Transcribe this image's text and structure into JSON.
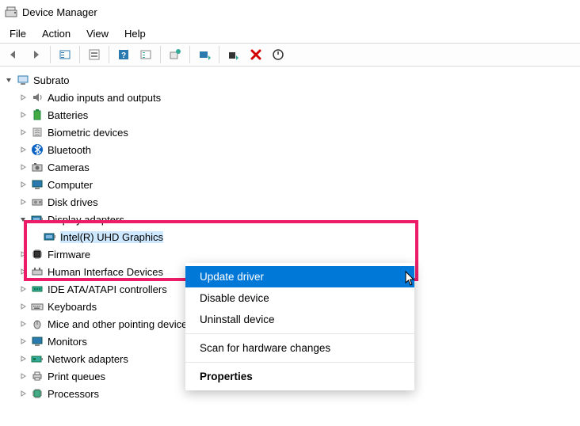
{
  "window": {
    "title": "Device Manager"
  },
  "menu": {
    "file": "File",
    "action": "Action",
    "view": "View",
    "help": "Help"
  },
  "root": {
    "name": "Subrato"
  },
  "categories": [
    {
      "id": "audio",
      "label": "Audio inputs and outputs"
    },
    {
      "id": "batteries",
      "label": "Batteries"
    },
    {
      "id": "biometric",
      "label": "Biometric devices"
    },
    {
      "id": "bluetooth",
      "label": "Bluetooth"
    },
    {
      "id": "cameras",
      "label": "Cameras"
    },
    {
      "id": "computer",
      "label": "Computer"
    },
    {
      "id": "disk",
      "label": "Disk drives"
    },
    {
      "id": "display",
      "label": "Display adapters"
    },
    {
      "id": "firmware",
      "label": "Firmware"
    },
    {
      "id": "hid",
      "label": "Human Interface Devices"
    },
    {
      "id": "ide",
      "label": "IDE ATA/ATAPI controllers"
    },
    {
      "id": "keyboards",
      "label": "Keyboards"
    },
    {
      "id": "mice",
      "label": "Mice and other pointing devices"
    },
    {
      "id": "monitors",
      "label": "Monitors"
    },
    {
      "id": "network",
      "label": "Network adapters"
    },
    {
      "id": "printq",
      "label": "Print queues"
    },
    {
      "id": "processors",
      "label": "Processors"
    }
  ],
  "display_child": {
    "label": "Intel(R) UHD Graphics"
  },
  "context_menu": {
    "update": "Update driver",
    "disable": "Disable device",
    "uninstall": "Uninstall device",
    "scan": "Scan for hardware changes",
    "properties": "Properties"
  }
}
